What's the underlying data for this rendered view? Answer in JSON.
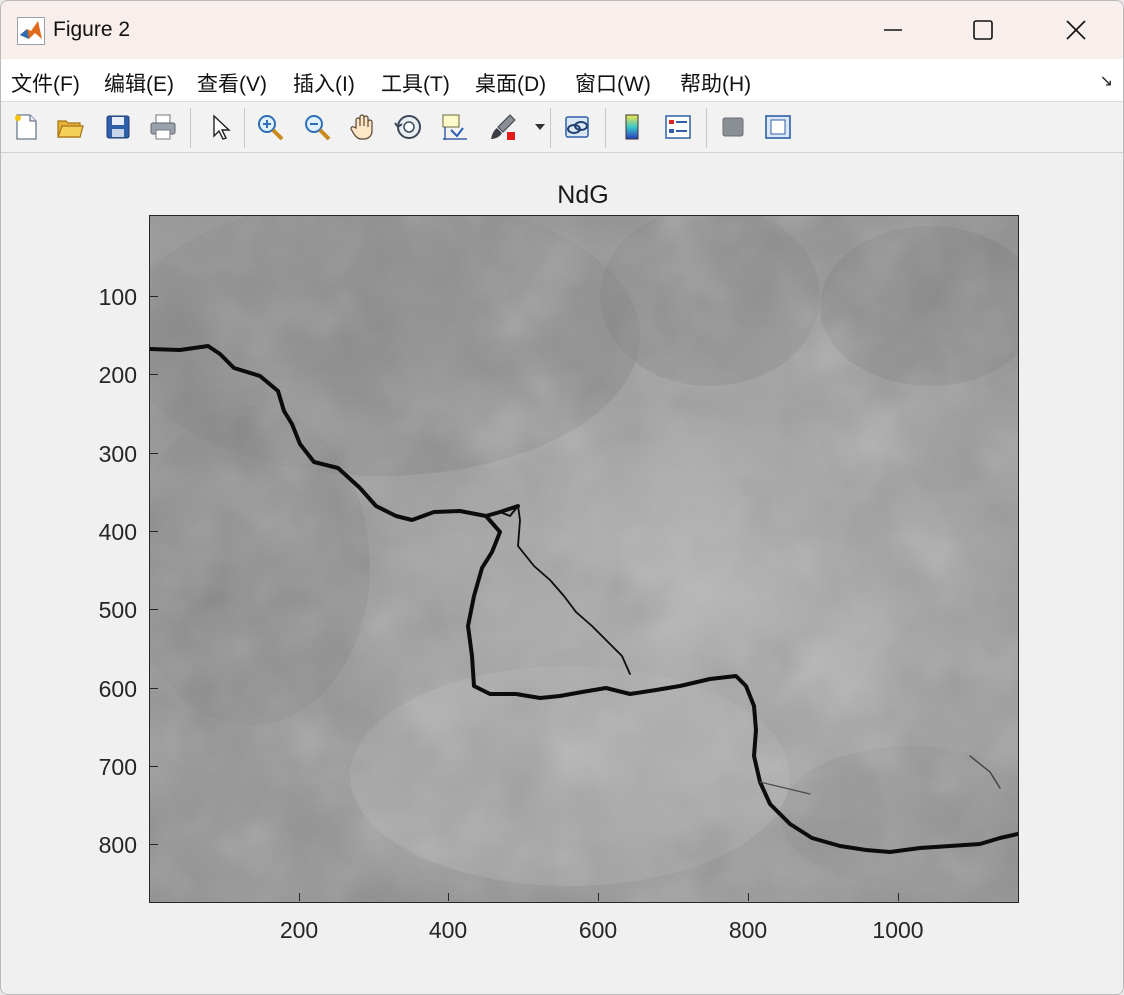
{
  "window": {
    "title": "Figure 2",
    "controls": [
      "minimize",
      "maximize",
      "close"
    ]
  },
  "menu": {
    "items": [
      {
        "label": "文件(F)"
      },
      {
        "label": "编辑(E)"
      },
      {
        "label": "查看(V)"
      },
      {
        "label": "插入(I)"
      },
      {
        "label": "工具(T)"
      },
      {
        "label": "桌面(D)"
      },
      {
        "label": "窗口(W)"
      },
      {
        "label": "帮助(H)"
      }
    ]
  },
  "toolbar": {
    "icons": [
      "new-figure-icon",
      "open-file-icon",
      "save-icon",
      "print-icon",
      "pointer-icon",
      "zoom-in-icon",
      "zoom-out-icon",
      "pan-icon",
      "rotate-3d-icon",
      "data-cursor-icon",
      "brush-icon",
      "link-plot-icon",
      "colorbar-icon",
      "legend-icon",
      "hide-plot-tools-icon",
      "show-plot-tools-icon"
    ]
  },
  "plot": {
    "title": "NdG",
    "yticks": [
      "100",
      "200",
      "300",
      "400",
      "500",
      "600",
      "700",
      "800"
    ],
    "xticks": [
      "200",
      "400",
      "600",
      "800",
      "1000"
    ],
    "image_description": "grayscale photo of cracked concrete wall"
  },
  "colors": {
    "titlebar": "#f8eeec",
    "figure_bg": "#f0f0f0",
    "axes_border": "#262626"
  }
}
